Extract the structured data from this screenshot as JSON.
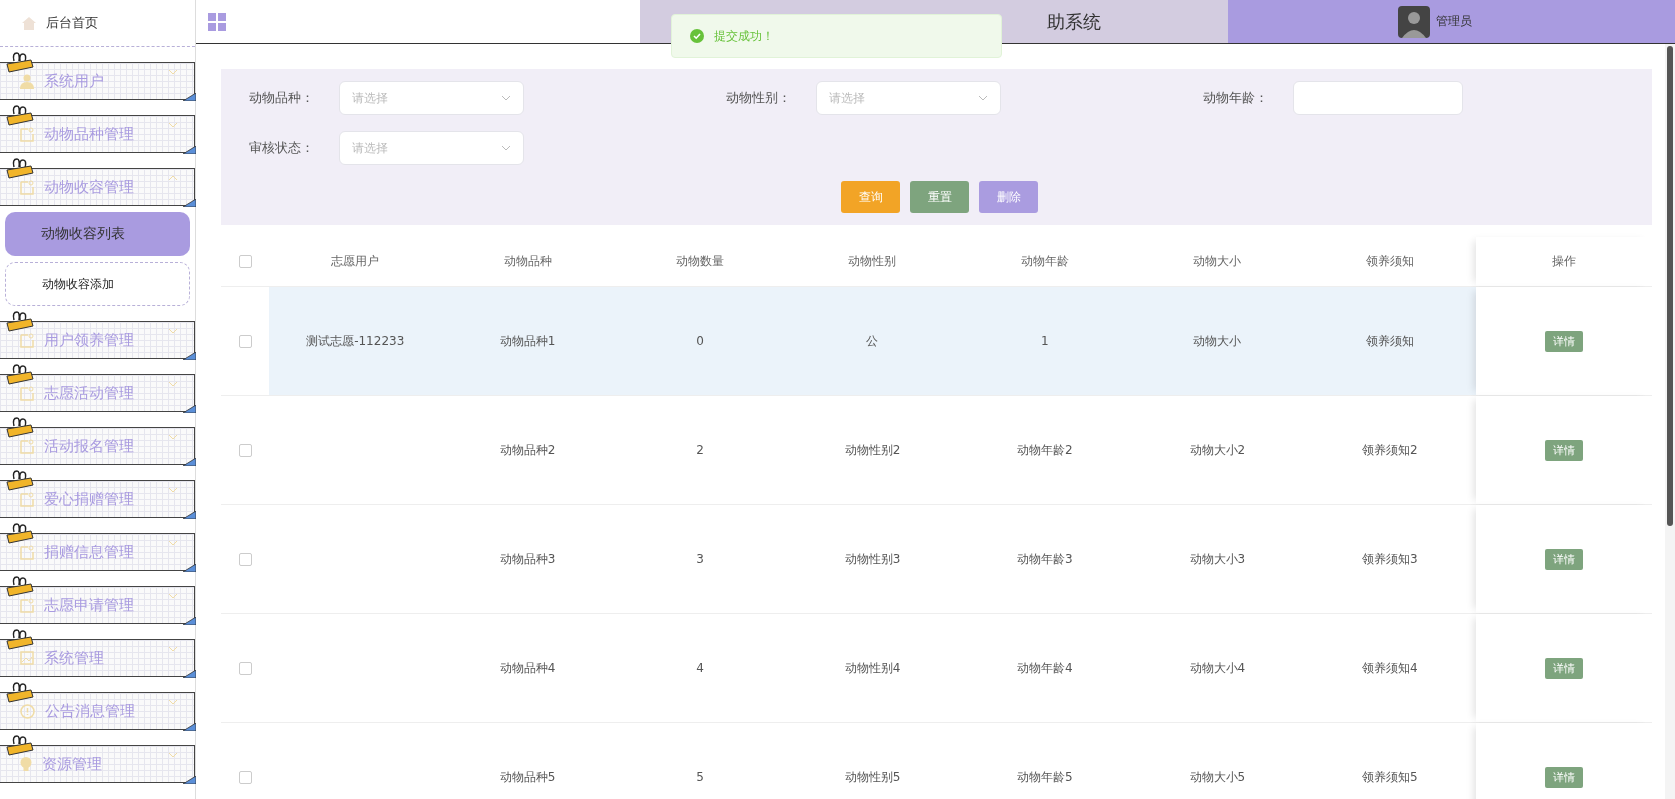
{
  "header": {
    "title": "助系统",
    "user": "管理员"
  },
  "toast": {
    "message": "提交成功！"
  },
  "sidebar": {
    "home": "后台首页",
    "items": [
      {
        "label": "系统用户",
        "kind": "user",
        "expanded": false
      },
      {
        "label": "动物品种管理",
        "kind": "doc",
        "expanded": false
      },
      {
        "label": "动物收容管理",
        "kind": "doc",
        "expanded": true,
        "children": [
          {
            "label": "动物收容列表",
            "selected": true
          },
          {
            "label": "动物收容添加",
            "selected": false
          }
        ]
      },
      {
        "label": "用户领养管理",
        "kind": "doc",
        "expanded": false
      },
      {
        "label": "志愿活动管理",
        "kind": "doc",
        "expanded": false
      },
      {
        "label": "活动报名管理",
        "kind": "doc",
        "expanded": false
      },
      {
        "label": "爱心捐赠管理",
        "kind": "doc",
        "expanded": false
      },
      {
        "label": "捐赠信息管理",
        "kind": "doc",
        "expanded": false
      },
      {
        "label": "志愿申请管理",
        "kind": "doc",
        "expanded": false
      },
      {
        "label": "系统管理",
        "kind": "image",
        "expanded": false
      },
      {
        "label": "公告消息管理",
        "kind": "info",
        "expanded": false
      },
      {
        "label": "资源管理",
        "kind": "bulb",
        "expanded": false
      }
    ]
  },
  "filters": [
    {
      "label": "动物品种：",
      "kind": "select",
      "placeholder": "请选择"
    },
    {
      "label": "动物性别：",
      "kind": "select",
      "placeholder": "请选择"
    },
    {
      "label": "动物年龄：",
      "kind": "input"
    },
    {
      "label": "审核状态：",
      "kind": "select",
      "placeholder": "请选择"
    }
  ],
  "buttons": [
    {
      "label": "查询",
      "kind": "query"
    },
    {
      "label": "重置",
      "kind": "reset"
    },
    {
      "label": "删除",
      "kind": "delete"
    }
  ],
  "table": {
    "select_all_checked": false,
    "columns": [
      "志愿用户",
      "动物品种",
      "动物数量",
      "动物性别",
      "动物年龄",
      "动物大小",
      "领养须知",
      "操作"
    ],
    "rows": [
      {
        "checked": false,
        "highlighted": true,
        "cells": [
          "测试志愿-112233",
          "动物品种1",
          "0",
          "公",
          "1",
          "动物大小",
          "领养须知"
        ],
        "action": "详情"
      },
      {
        "checked": false,
        "highlighted": false,
        "cells": [
          "",
          "动物品种2",
          "2",
          "动物性别2",
          "动物年龄2",
          "动物大小2",
          "领养须知2"
        ],
        "action": "详情"
      },
      {
        "checked": false,
        "highlighted": false,
        "cells": [
          "",
          "动物品种3",
          "3",
          "动物性别3",
          "动物年龄3",
          "动物大小3",
          "领养须知3"
        ],
        "action": "详情"
      },
      {
        "checked": false,
        "highlighted": false,
        "cells": [
          "",
          "动物品种4",
          "4",
          "动物性别4",
          "动物年龄4",
          "动物大小4",
          "领养须知4"
        ],
        "action": "详情"
      },
      {
        "checked": false,
        "highlighted": false,
        "cells": [
          "",
          "动物品种5",
          "5",
          "动物性别5",
          "动物年龄5",
          "动物大小5",
          "领养须知5"
        ],
        "action": "详情"
      }
    ]
  }
}
